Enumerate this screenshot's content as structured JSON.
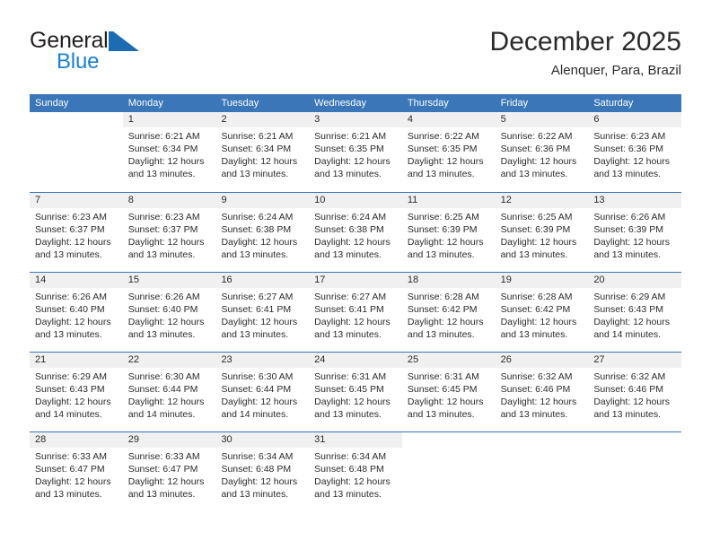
{
  "brand": {
    "name_part1": "General",
    "name_part2": "Blue",
    "mark": "triangle-logo"
  },
  "header": {
    "title": "December 2025",
    "subtitle": "Alenquer, Para, Brazil"
  },
  "colors": {
    "header_blue": "#3a76b8",
    "brand_blue": "#1b7fd4",
    "daynum_band": "#f0f0f0",
    "text": "#2b2b2b"
  },
  "weekdays": [
    "Sunday",
    "Monday",
    "Tuesday",
    "Wednesday",
    "Thursday",
    "Friday",
    "Saturday"
  ],
  "weeks": [
    [
      {
        "day": "",
        "blank": true,
        "sunrise": "",
        "sunset": "",
        "daylight1": "",
        "daylight2": ""
      },
      {
        "day": "1",
        "sunrise": "Sunrise: 6:21 AM",
        "sunset": "Sunset: 6:34 PM",
        "daylight1": "Daylight: 12 hours",
        "daylight2": "and 13 minutes."
      },
      {
        "day": "2",
        "sunrise": "Sunrise: 6:21 AM",
        "sunset": "Sunset: 6:34 PM",
        "daylight1": "Daylight: 12 hours",
        "daylight2": "and 13 minutes."
      },
      {
        "day": "3",
        "sunrise": "Sunrise: 6:21 AM",
        "sunset": "Sunset: 6:35 PM",
        "daylight1": "Daylight: 12 hours",
        "daylight2": "and 13 minutes."
      },
      {
        "day": "4",
        "sunrise": "Sunrise: 6:22 AM",
        "sunset": "Sunset: 6:35 PM",
        "daylight1": "Daylight: 12 hours",
        "daylight2": "and 13 minutes."
      },
      {
        "day": "5",
        "sunrise": "Sunrise: 6:22 AM",
        "sunset": "Sunset: 6:36 PM",
        "daylight1": "Daylight: 12 hours",
        "daylight2": "and 13 minutes."
      },
      {
        "day": "6",
        "sunrise": "Sunrise: 6:23 AM",
        "sunset": "Sunset: 6:36 PM",
        "daylight1": "Daylight: 12 hours",
        "daylight2": "and 13 minutes."
      }
    ],
    [
      {
        "day": "7",
        "sunrise": "Sunrise: 6:23 AM",
        "sunset": "Sunset: 6:37 PM",
        "daylight1": "Daylight: 12 hours",
        "daylight2": "and 13 minutes."
      },
      {
        "day": "8",
        "sunrise": "Sunrise: 6:23 AM",
        "sunset": "Sunset: 6:37 PM",
        "daylight1": "Daylight: 12 hours",
        "daylight2": "and 13 minutes."
      },
      {
        "day": "9",
        "sunrise": "Sunrise: 6:24 AM",
        "sunset": "Sunset: 6:38 PM",
        "daylight1": "Daylight: 12 hours",
        "daylight2": "and 13 minutes."
      },
      {
        "day": "10",
        "sunrise": "Sunrise: 6:24 AM",
        "sunset": "Sunset: 6:38 PM",
        "daylight1": "Daylight: 12 hours",
        "daylight2": "and 13 minutes."
      },
      {
        "day": "11",
        "sunrise": "Sunrise: 6:25 AM",
        "sunset": "Sunset: 6:39 PM",
        "daylight1": "Daylight: 12 hours",
        "daylight2": "and 13 minutes."
      },
      {
        "day": "12",
        "sunrise": "Sunrise: 6:25 AM",
        "sunset": "Sunset: 6:39 PM",
        "daylight1": "Daylight: 12 hours",
        "daylight2": "and 13 minutes."
      },
      {
        "day": "13",
        "sunrise": "Sunrise: 6:26 AM",
        "sunset": "Sunset: 6:39 PM",
        "daylight1": "Daylight: 12 hours",
        "daylight2": "and 13 minutes."
      }
    ],
    [
      {
        "day": "14",
        "sunrise": "Sunrise: 6:26 AM",
        "sunset": "Sunset: 6:40 PM",
        "daylight1": "Daylight: 12 hours",
        "daylight2": "and 13 minutes."
      },
      {
        "day": "15",
        "sunrise": "Sunrise: 6:26 AM",
        "sunset": "Sunset: 6:40 PM",
        "daylight1": "Daylight: 12 hours",
        "daylight2": "and 13 minutes."
      },
      {
        "day": "16",
        "sunrise": "Sunrise: 6:27 AM",
        "sunset": "Sunset: 6:41 PM",
        "daylight1": "Daylight: 12 hours",
        "daylight2": "and 13 minutes."
      },
      {
        "day": "17",
        "sunrise": "Sunrise: 6:27 AM",
        "sunset": "Sunset: 6:41 PM",
        "daylight1": "Daylight: 12 hours",
        "daylight2": "and 13 minutes."
      },
      {
        "day": "18",
        "sunrise": "Sunrise: 6:28 AM",
        "sunset": "Sunset: 6:42 PM",
        "daylight1": "Daylight: 12 hours",
        "daylight2": "and 13 minutes."
      },
      {
        "day": "19",
        "sunrise": "Sunrise: 6:28 AM",
        "sunset": "Sunset: 6:42 PM",
        "daylight1": "Daylight: 12 hours",
        "daylight2": "and 13 minutes."
      },
      {
        "day": "20",
        "sunrise": "Sunrise: 6:29 AM",
        "sunset": "Sunset: 6:43 PM",
        "daylight1": "Daylight: 12 hours",
        "daylight2": "and 14 minutes."
      }
    ],
    [
      {
        "day": "21",
        "sunrise": "Sunrise: 6:29 AM",
        "sunset": "Sunset: 6:43 PM",
        "daylight1": "Daylight: 12 hours",
        "daylight2": "and 14 minutes."
      },
      {
        "day": "22",
        "sunrise": "Sunrise: 6:30 AM",
        "sunset": "Sunset: 6:44 PM",
        "daylight1": "Daylight: 12 hours",
        "daylight2": "and 14 minutes."
      },
      {
        "day": "23",
        "sunrise": "Sunrise: 6:30 AM",
        "sunset": "Sunset: 6:44 PM",
        "daylight1": "Daylight: 12 hours",
        "daylight2": "and 14 minutes."
      },
      {
        "day": "24",
        "sunrise": "Sunrise: 6:31 AM",
        "sunset": "Sunset: 6:45 PM",
        "daylight1": "Daylight: 12 hours",
        "daylight2": "and 13 minutes."
      },
      {
        "day": "25",
        "sunrise": "Sunrise: 6:31 AM",
        "sunset": "Sunset: 6:45 PM",
        "daylight1": "Daylight: 12 hours",
        "daylight2": "and 13 minutes."
      },
      {
        "day": "26",
        "sunrise": "Sunrise: 6:32 AM",
        "sunset": "Sunset: 6:46 PM",
        "daylight1": "Daylight: 12 hours",
        "daylight2": "and 13 minutes."
      },
      {
        "day": "27",
        "sunrise": "Sunrise: 6:32 AM",
        "sunset": "Sunset: 6:46 PM",
        "daylight1": "Daylight: 12 hours",
        "daylight2": "and 13 minutes."
      }
    ],
    [
      {
        "day": "28",
        "sunrise": "Sunrise: 6:33 AM",
        "sunset": "Sunset: 6:47 PM",
        "daylight1": "Daylight: 12 hours",
        "daylight2": "and 13 minutes."
      },
      {
        "day": "29",
        "sunrise": "Sunrise: 6:33 AM",
        "sunset": "Sunset: 6:47 PM",
        "daylight1": "Daylight: 12 hours",
        "daylight2": "and 13 minutes."
      },
      {
        "day": "30",
        "sunrise": "Sunrise: 6:34 AM",
        "sunset": "Sunset: 6:48 PM",
        "daylight1": "Daylight: 12 hours",
        "daylight2": "and 13 minutes."
      },
      {
        "day": "31",
        "sunrise": "Sunrise: 6:34 AM",
        "sunset": "Sunset: 6:48 PM",
        "daylight1": "Daylight: 12 hours",
        "daylight2": "and 13 minutes."
      },
      {
        "day": "",
        "blank": true,
        "sunrise": "",
        "sunset": "",
        "daylight1": "",
        "daylight2": ""
      },
      {
        "day": "",
        "blank": true,
        "sunrise": "",
        "sunset": "",
        "daylight1": "",
        "daylight2": ""
      },
      {
        "day": "",
        "blank": true,
        "sunrise": "",
        "sunset": "",
        "daylight1": "",
        "daylight2": ""
      }
    ]
  ]
}
